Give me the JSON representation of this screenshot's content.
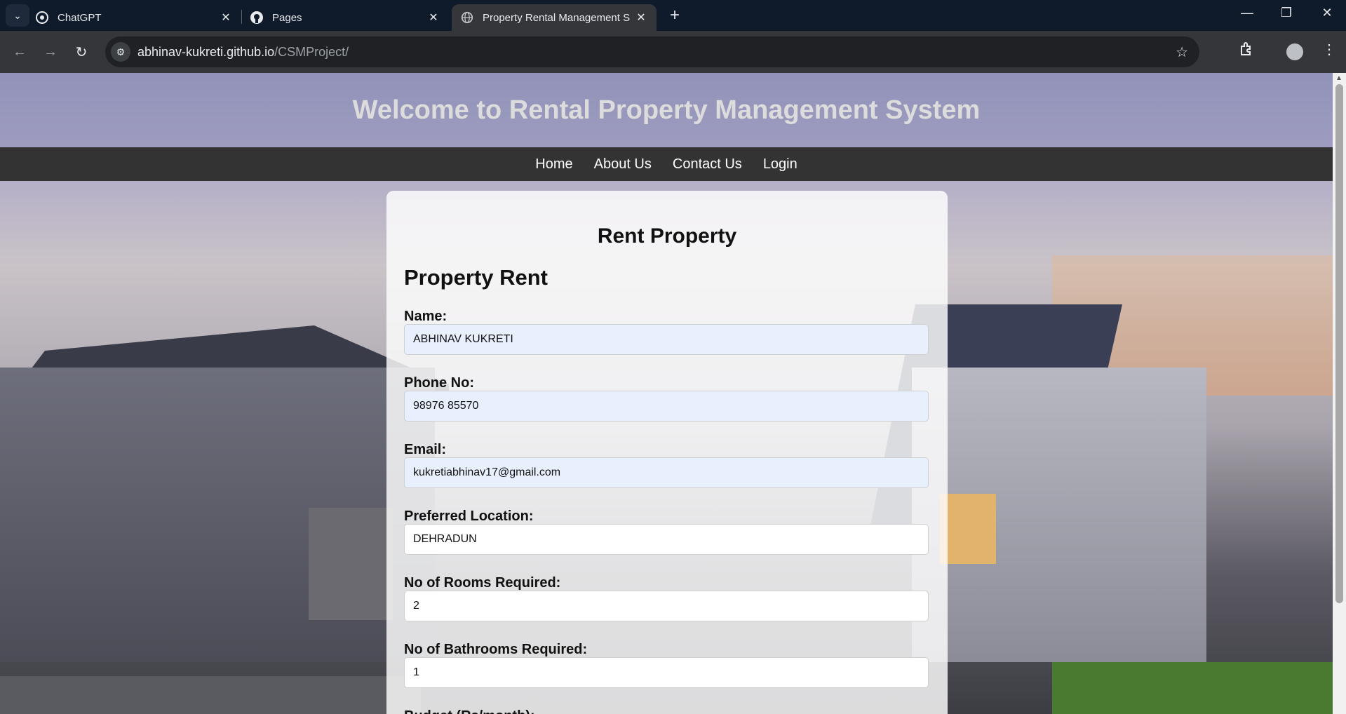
{
  "browser": {
    "tabs": [
      {
        "title": "ChatGPT",
        "icon": "chatgpt-icon"
      },
      {
        "title": "Pages",
        "icon": "github-icon"
      },
      {
        "title": "Property Rental Management S",
        "icon": "globe-icon",
        "active": true
      }
    ],
    "url_host": "abhinav-kukreti.github.io",
    "url_path": "/CSMProject/"
  },
  "page": {
    "header_title": "Welcome to Rental Property Management System",
    "nav": [
      "Home",
      "About Us",
      "Contact Us",
      "Login"
    ],
    "card_title": "Rent Property",
    "form_title": "Property Rent",
    "fields": [
      {
        "label": "Name:",
        "value": "ABHINAV KUKRETI",
        "autofill": true
      },
      {
        "label": "Phone No:",
        "value": "98976 85570",
        "autofill": true
      },
      {
        "label": "Email:",
        "value": "kukretiabhinav17@gmail.com",
        "autofill": true
      },
      {
        "label": "Preferred Location:",
        "value": "DEHRADUN",
        "autofill": false
      },
      {
        "label": "No of Rooms Required:",
        "value": "2",
        "autofill": false
      },
      {
        "label": "No of Bathrooms Required:",
        "value": "1",
        "autofill": false
      },
      {
        "label": "Budget (Rs/month):",
        "value": "",
        "autofill": false
      }
    ]
  }
}
